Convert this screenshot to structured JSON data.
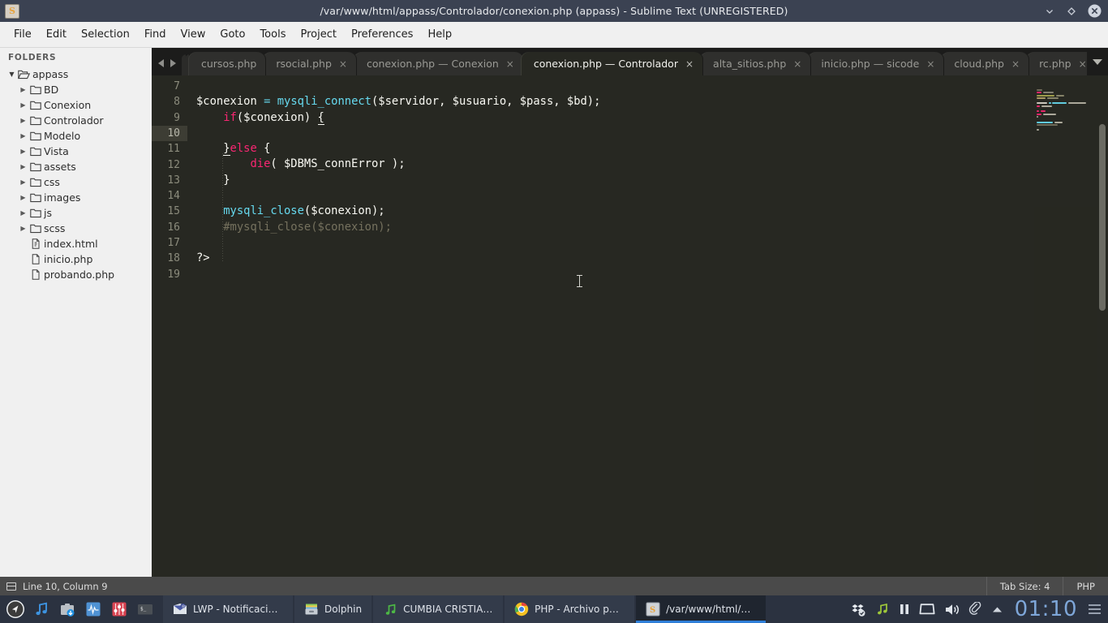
{
  "titlebar": {
    "title": "/var/www/html/appass/Controlador/conexion.php (appass) - Sublime Text (UNREGISTERED)",
    "app_icon_letter": "S",
    "buttons": [
      {
        "name": "minimize-button",
        "glyph": "⌄"
      },
      {
        "name": "maximize-button",
        "glyph": "◇"
      },
      {
        "name": "close-button",
        "glyph": "✕"
      }
    ]
  },
  "menubar": {
    "items": [
      "File",
      "Edit",
      "Selection",
      "Find",
      "View",
      "Goto",
      "Tools",
      "Project",
      "Preferences",
      "Help"
    ]
  },
  "sidebar": {
    "header": "FOLDERS",
    "root": {
      "label": "appass",
      "expanded": true
    },
    "folders": [
      "BD",
      "Conexion",
      "Controlador",
      "Modelo",
      "Vista",
      "assets",
      "css",
      "images",
      "js",
      "scss"
    ],
    "files": [
      "index.html",
      "inicio.php",
      "probando.php"
    ]
  },
  "tabs": {
    "items": [
      {
        "label": "cursos.php",
        "active": false,
        "closable": false
      },
      {
        "label": "rsocial.php",
        "active": false,
        "closable": true
      },
      {
        "label": "conexion.php — Conexion",
        "active": false,
        "closable": true
      },
      {
        "label": "conexion.php — Controlador",
        "active": true,
        "closable": true
      },
      {
        "label": "alta_sitios.php",
        "active": false,
        "closable": true
      },
      {
        "label": "inicio.php — sicode",
        "active": false,
        "closable": true
      },
      {
        "label": "cloud.php",
        "active": false,
        "closable": true
      },
      {
        "label": "rc.php",
        "active": false,
        "closable": true
      }
    ],
    "close_glyph": "×",
    "overflow_label": "▼"
  },
  "editor": {
    "first_line": 7,
    "active_line": 10,
    "lines": [
      {
        "num": 7,
        "tokens": []
      },
      {
        "num": 8,
        "tokens": [
          {
            "t": "$conexion ",
            "c": "tokt"
          },
          {
            "t": "=",
            "c": "tokop"
          },
          {
            "t": " ",
            "c": "tokt"
          },
          {
            "t": "mysqli_connect",
            "c": "tokf"
          },
          {
            "t": "($servidor, $usuario, $pass, $bd);",
            "c": "tokp"
          }
        ]
      },
      {
        "num": 9,
        "tokens": [
          {
            "t": "    ",
            "c": "tokt"
          },
          {
            "t": "if",
            "c": "tokw"
          },
          {
            "t": "($conexion) ",
            "c": "tokp"
          },
          {
            "t": "{",
            "c": "tokp brace-match"
          }
        ]
      },
      {
        "num": 10,
        "tokens": []
      },
      {
        "num": 11,
        "tokens": [
          {
            "t": "    ",
            "c": "tokt"
          },
          {
            "t": "}",
            "c": "tokp brace-match"
          },
          {
            "t": "else",
            "c": "tokw"
          },
          {
            "t": " {",
            "c": "tokp"
          }
        ]
      },
      {
        "num": 12,
        "tokens": [
          {
            "t": "        ",
            "c": "tokt"
          },
          {
            "t": "die",
            "c": "tokw"
          },
          {
            "t": "( $DBMS_connError );",
            "c": "tokp"
          }
        ]
      },
      {
        "num": 13,
        "tokens": [
          {
            "t": "    }",
            "c": "tokp"
          }
        ]
      },
      {
        "num": 14,
        "tokens": []
      },
      {
        "num": 15,
        "tokens": [
          {
            "t": "    ",
            "c": "tokt"
          },
          {
            "t": "mysqli_close",
            "c": "tokf"
          },
          {
            "t": "($conexion);",
            "c": "tokp"
          }
        ]
      },
      {
        "num": 16,
        "tokens": [
          {
            "t": "    #mysqli_close($conexion);",
            "c": "tokc"
          }
        ]
      },
      {
        "num": 17,
        "tokens": []
      },
      {
        "num": 18,
        "tokens": [
          {
            "t": "?>",
            "c": "tokp"
          }
        ]
      },
      {
        "num": 19,
        "tokens": []
      }
    ],
    "plain_text": "\n$conexion = mysqli_connect($servidor, $usuario, $pass, $bd);\n    if($conexion) {\n\n    }else {\n        die( $DBMS_connError );\n    }\n\n    mysqli_close($conexion);\n    #mysqli_close($conexion);\n\n?>\n"
  },
  "statusbar": {
    "cursor": "Line 10, Column 9",
    "tab_size": "Tab Size: 4",
    "syntax": "PHP"
  },
  "taskbar": {
    "launchers": [
      {
        "name": "app-launcher-icon"
      },
      {
        "name": "music-note-icon"
      },
      {
        "name": "software-updater-icon"
      },
      {
        "name": "system-monitor-icon"
      },
      {
        "name": "audio-mixer-icon"
      },
      {
        "name": "terminal-icon"
      }
    ],
    "tasks": [
      {
        "label": "LWP - Notificación ...",
        "icon": "mail-icon",
        "active": false
      },
      {
        "label": "Dolphin",
        "icon": "dolphin-icon",
        "active": false
      },
      {
        "label": "CUMBIA CRISTIAN...",
        "icon": "music-note-icon",
        "active": false
      },
      {
        "label": "PHP - Archivo php ...",
        "icon": "chrome-icon",
        "active": false
      },
      {
        "label": "/var/www/html/ap...",
        "icon": "sublime-icon",
        "active": true
      }
    ],
    "tray": [
      {
        "name": "dropbox-sync-icon"
      },
      {
        "name": "music-note-icon"
      },
      {
        "name": "media-pause-icon"
      },
      {
        "name": "display-icon"
      },
      {
        "name": "volume-icon"
      },
      {
        "name": "clipboard-icon"
      },
      {
        "name": "show-hidden-icons-icon"
      }
    ],
    "clock": "01:10",
    "menu_icon": "hamburger-menu-icon"
  },
  "colors": {
    "titlebar_bg": "#3b4252",
    "menubar_bg": "#f0f0f0",
    "sidebar_bg": "#f0f0f0",
    "editor_bg": "#272822",
    "tabbar_bg": "#1c1c1b",
    "statusbar_bg": "#4a4a4a",
    "taskbar_bg": "#2b3240",
    "keyword": "#f92672",
    "function": "#66d9ef",
    "comment": "#75715e",
    "text": "#f8f8f2",
    "active_task_accent": "#2f7fd8",
    "clock_color": "#7ea6d8"
  }
}
